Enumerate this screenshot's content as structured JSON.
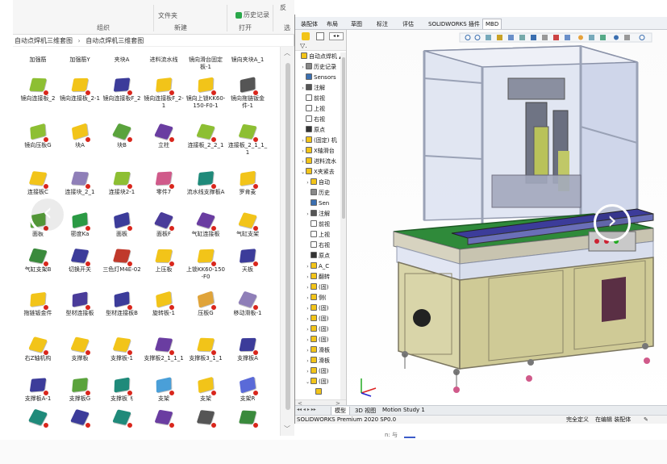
{
  "ribbon": {
    "file_label": "文件夹",
    "history_label": "历史记录",
    "more_label": "反",
    "group_organize": "组织",
    "group_new": "新建",
    "group_open": "打开",
    "group_select": "选"
  },
  "breadcrumb": {
    "p1": "自动点焊机三维套图",
    "sep": "›",
    "p2": "自动点焊机三维套图"
  },
  "files": [
    {
      "label": "加强筋",
      "icon": "beam-part-icon",
      "color": "#c9a227"
    },
    {
      "label": "加强筋Y",
      "icon": "beam-part-icon",
      "color": "#c9a227"
    },
    {
      "label": "夹块A",
      "icon": "block-part-icon",
      "color": "#c9a227"
    },
    {
      "label": "进料流水线",
      "icon": "conveyor-assembly-icon",
      "color": "#4a58b8"
    },
    {
      "label": "镜向滑台固定板-1",
      "icon": "plate-part-icon",
      "color": "#c9a227"
    },
    {
      "label": "镜向夹块A_1",
      "icon": "block-part-icon",
      "color": "#c9a227"
    },
    {
      "label": "镜向连接板_2",
      "icon": "bracket-part-icon",
      "color": "#8dbf33"
    },
    {
      "label": "镜向连接板_2-1",
      "icon": "assembly-part-icon",
      "color": "#f2c419"
    },
    {
      "label": "镜向连接板F_2",
      "icon": "bracket-part-icon",
      "color": "#3c3c9a"
    },
    {
      "label": "镜向连接板F_2-1",
      "icon": "assembly-part-icon",
      "color": "#f2c419"
    },
    {
      "label": "镜向上锁KK60-150-F0-1",
      "icon": "assembly-part-icon",
      "color": "#f2c419"
    },
    {
      "label": "镜向拖链钣金件-1",
      "icon": "sheet-metal-icon",
      "color": "#555555"
    },
    {
      "label": "镜向压板G",
      "icon": "clamp-plate-icon",
      "color": "#8dbf33"
    },
    {
      "label": "块A",
      "icon": "assembly-part-icon",
      "color": "#f2c419"
    },
    {
      "label": "块B",
      "icon": "block-part-icon",
      "color": "#5aa33c"
    },
    {
      "label": "立柱",
      "icon": "column-part-icon",
      "color": "#6a3da1"
    },
    {
      "label": "连接板_2_2_1",
      "icon": "bracket-part-icon",
      "color": "#8dbf33"
    },
    {
      "label": "连接板_2_1_1_1",
      "icon": "bracket-part-icon",
      "color": "#8dbf33"
    },
    {
      "label": "连接板C",
      "icon": "assembly-part-icon",
      "color": "#f2c419"
    },
    {
      "label": "连接块_2_1",
      "icon": "connector-part-icon",
      "color": "#8f7fb8"
    },
    {
      "label": "连接块2-1",
      "icon": "connector-part-icon",
      "color": "#8dbf33"
    },
    {
      "label": "零件7",
      "icon": "rod-part-icon",
      "color": "#d05a8a"
    },
    {
      "label": "流水线支撑板A",
      "icon": "support-plate-icon",
      "color": "#1f8a7a"
    },
    {
      "label": "罗肯麦",
      "icon": "assembly-part-icon",
      "color": "#f2c419"
    },
    {
      "label": "面板",
      "icon": "panel-part-icon",
      "color": "#5aa33c"
    },
    {
      "label": "密度Ka",
      "icon": "panel-part-icon",
      "color": "#2b9a44"
    },
    {
      "label": "面板",
      "icon": "panel-part-icon",
      "color": "#3c3c9a"
    },
    {
      "label": "面板F",
      "icon": "panel-part-icon",
      "color": "#4a3c9a"
    },
    {
      "label": "气缸连接板",
      "icon": "panel-part-icon",
      "color": "#6a3da1"
    },
    {
      "label": "气缸支架",
      "icon": "assembly-part-icon",
      "color": "#f2c419"
    },
    {
      "label": "气缸支架B",
      "icon": "bracket-part-icon",
      "color": "#3a8a3c"
    },
    {
      "label": "切换开关",
      "icon": "switch-part-icon",
      "color": "#3c3c9a"
    },
    {
      "label": "三色灯M4E-02",
      "icon": "lamp-part-icon",
      "color": "#c0392b"
    },
    {
      "label": "上压板",
      "icon": "assembly-part-icon",
      "color": "#f2c419"
    },
    {
      "label": "上锁KK60-150-F0",
      "icon": "assembly-part-icon",
      "color": "#f2c419"
    },
    {
      "label": "天板",
      "icon": "panel-part-icon",
      "color": "#3c3c9a"
    },
    {
      "label": "拖链钣金件",
      "icon": "assembly-part-icon",
      "color": "#f2c419"
    },
    {
      "label": "型材连接板",
      "icon": "bracket-part-icon",
      "color": "#4a3c9a"
    },
    {
      "label": "型材连接板B",
      "icon": "bracket-part-icon",
      "color": "#3c3c9a"
    },
    {
      "label": "旋转板-1",
      "icon": "assembly-part-icon",
      "color": "#f2c419"
    },
    {
      "label": "压板G",
      "icon": "clamp-plate-icon",
      "color": "#e0a43a"
    },
    {
      "label": "移动滑板-1",
      "icon": "slide-plate-icon",
      "color": "#8f7fb8"
    },
    {
      "label": "右Z轴机构",
      "icon": "assembly-part-icon",
      "color": "#f2c419"
    },
    {
      "label": "支撑板",
      "icon": "assembly-part-icon",
      "color": "#f2c419"
    },
    {
      "label": "支撑板-1",
      "icon": "assembly-part-icon",
      "color": "#f2c419"
    },
    {
      "label": "支撑板2_1_1_1",
      "icon": "column-part-icon",
      "color": "#6a3da1"
    },
    {
      "label": "支撑板3_1_1",
      "icon": "assembly-part-icon",
      "color": "#f2c419"
    },
    {
      "label": "支撑板A",
      "icon": "column-part-icon",
      "color": "#3c3c9a"
    },
    {
      "label": "支撑板A-1",
      "icon": "panel-part-icon",
      "color": "#3c3c9a"
    },
    {
      "label": "支撑板G",
      "icon": "frame-part-icon",
      "color": "#5aa33c"
    },
    {
      "label": "支撑板飞",
      "icon": "connector-part-icon",
      "color": "#1f8a7a"
    },
    {
      "label": "支架",
      "icon": "block-part-icon",
      "color": "#4a9fd8"
    },
    {
      "label": "支架",
      "icon": "assembly-part-icon",
      "color": "#f2c419"
    },
    {
      "label": "支架R",
      "icon": "bracket-part-icon",
      "color": "#5a6ad8"
    },
    {
      "label": "",
      "icon": "rod-part-icon",
      "color": "#1f8a7a"
    },
    {
      "label": "",
      "icon": "rod-part-icon",
      "color": "#3c3c9a"
    },
    {
      "label": "",
      "icon": "rod-part-icon",
      "color": "#1f8a7a"
    },
    {
      "label": "",
      "icon": "block-part-icon",
      "color": "#6a3da1"
    },
    {
      "label": "",
      "icon": "rod-part-icon",
      "color": "#555555"
    },
    {
      "label": "",
      "icon": "assembly-part-icon",
      "color": "#3a8a3c"
    }
  ],
  "sw": {
    "tabs": [
      "装配体",
      "布局",
      "草图",
      "标注",
      "评估",
      "SOLIDWORKS 插件",
      "MBD"
    ],
    "active_tab": "MBD",
    "tree": [
      {
        "t": "自动点焊机 ▲",
        "icon": "assembly-icon",
        "indent": 0,
        "exp": ""
      },
      {
        "t": "历史记录",
        "icon": "history-icon",
        "indent": 1,
        "exp": "›"
      },
      {
        "t": "Sensors",
        "icon": "sensor-icon",
        "indent": 1,
        "exp": ""
      },
      {
        "t": "注解",
        "icon": "annotation-icon",
        "indent": 1,
        "exp": "›"
      },
      {
        "t": "前视",
        "icon": "plane-icon",
        "indent": 1,
        "exp": ""
      },
      {
        "t": "上视",
        "icon": "plane-icon",
        "indent": 1,
        "exp": ""
      },
      {
        "t": "右视",
        "icon": "plane-icon",
        "indent": 1,
        "exp": ""
      },
      {
        "t": "原点",
        "icon": "origin-icon",
        "indent": 1,
        "exp": ""
      },
      {
        "t": "(固定) 机",
        "icon": "assembly-icon",
        "indent": 1,
        "exp": "›"
      },
      {
        "t": "X轴滑台",
        "icon": "assembly-icon",
        "indent": 1,
        "exp": "›"
      },
      {
        "t": "进料流水",
        "icon": "assembly-icon",
        "indent": 1,
        "exp": "›"
      },
      {
        "t": "X夹紧去",
        "icon": "assembly-icon",
        "indent": 1,
        "exp": "⌄"
      },
      {
        "t": "自动",
        "icon": "assembly-icon",
        "indent": 2,
        "exp": "›"
      },
      {
        "t": "历史",
        "icon": "history-icon",
        "indent": 2,
        "exp": ""
      },
      {
        "t": "Sen",
        "icon": "sensor-icon",
        "indent": 2,
        "exp": ""
      },
      {
        "t": "注解",
        "icon": "annotation-icon",
        "indent": 2,
        "exp": "›"
      },
      {
        "t": "前视",
        "icon": "plane-icon",
        "indent": 2,
        "exp": ""
      },
      {
        "t": "上视",
        "icon": "plane-icon",
        "indent": 2,
        "exp": ""
      },
      {
        "t": "右视",
        "icon": "plane-icon",
        "indent": 2,
        "exp": ""
      },
      {
        "t": "原点",
        "icon": "origin-icon",
        "indent": 2,
        "exp": ""
      },
      {
        "t": "A_C",
        "icon": "part-icon",
        "indent": 2,
        "exp": "›"
      },
      {
        "t": "翻转",
        "icon": "part-icon",
        "indent": 2,
        "exp": "›"
      },
      {
        "t": "(固)",
        "icon": "part-icon",
        "indent": 2,
        "exp": "›"
      },
      {
        "t": "侧(",
        "icon": "part-icon",
        "indent": 2,
        "exp": "›"
      },
      {
        "t": "(固)",
        "icon": "part-icon",
        "indent": 2,
        "exp": "›"
      },
      {
        "t": "(固)",
        "icon": "part-icon",
        "indent": 2,
        "exp": "›"
      },
      {
        "t": "(固)",
        "icon": "part-icon",
        "indent": 2,
        "exp": "›"
      },
      {
        "t": "(固)",
        "icon": "part-icon",
        "indent": 2,
        "exp": "›"
      },
      {
        "t": "滑板",
        "icon": "part-icon",
        "indent": 2,
        "exp": "›"
      },
      {
        "t": "滑板",
        "icon": "part-icon",
        "indent": 2,
        "exp": "›"
      },
      {
        "t": "(固)",
        "icon": "part-icon",
        "indent": 2,
        "exp": "›"
      },
      {
        "t": "(固)",
        "icon": "part-icon",
        "indent": 2,
        "exp": "⌄"
      },
      {
        "t": "",
        "icon": "part-icon",
        "indent": 3,
        "exp": ""
      }
    ],
    "bottom_tabs": [
      "模型",
      "3D 视图",
      "Motion Study 1"
    ],
    "status_left": "SOLIDWORKS Premium 2020 SP0.0",
    "status_defined": "完全定义",
    "status_mode": "在编辑 装配体",
    "taskbar_hint": "n: 与"
  }
}
